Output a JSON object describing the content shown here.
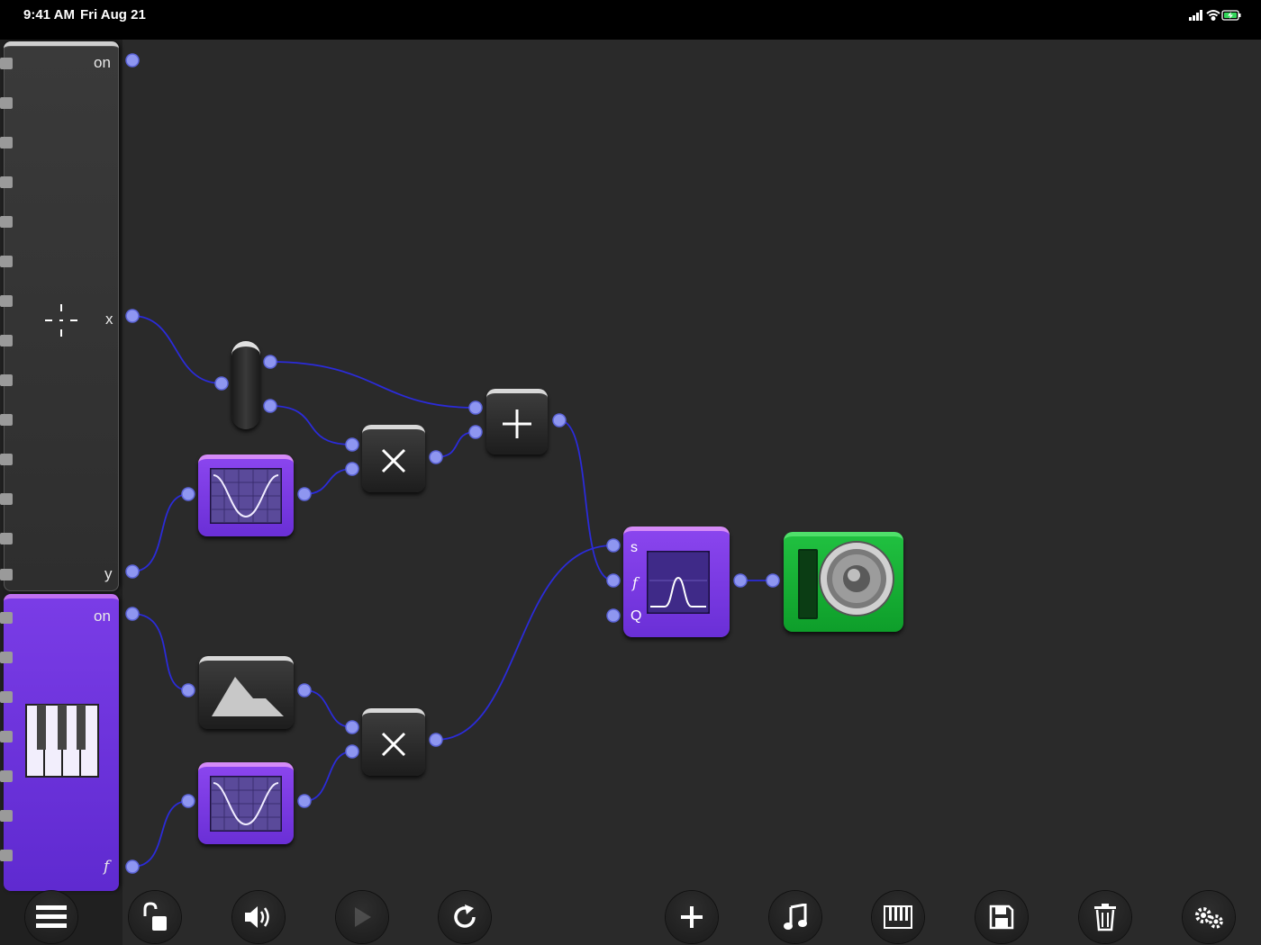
{
  "status_bar": {
    "time": "9:41 AM",
    "date": "Fri Aug 21",
    "icons": [
      "signal-icon",
      "wifi-icon",
      "battery-charging-icon"
    ]
  },
  "touchpad_module": {
    "on_label": "on",
    "x_label": "x",
    "y_label": "y"
  },
  "keyboard_module": {
    "on_label": "on",
    "f_label": "f"
  },
  "filter_module": {
    "s_label": "s",
    "f_label": "f",
    "q_label": "Q"
  },
  "nodes": [
    {
      "name": "switch-node",
      "icon": "pill-switch-icon"
    },
    {
      "name": "oscillator-node-top",
      "icon": "sine-wave-icon"
    },
    {
      "name": "multiply-node-top",
      "icon": "multiply-icon"
    },
    {
      "name": "add-node",
      "icon": "plus-icon"
    },
    {
      "name": "envelope-node",
      "icon": "envelope-icon"
    },
    {
      "name": "oscillator-node-bottom",
      "icon": "sine-wave-icon"
    },
    {
      "name": "multiply-node-bottom",
      "icon": "multiply-icon"
    },
    {
      "name": "filter-node",
      "icon": "bandpass-icon"
    },
    {
      "name": "speaker-node",
      "icon": "speaker-icon"
    }
  ],
  "toolbar": [
    {
      "name": "menu-button",
      "icon": "menu-icon"
    },
    {
      "name": "lock-button",
      "icon": "unlock-icon"
    },
    {
      "name": "volume-button",
      "icon": "volume-icon"
    },
    {
      "name": "play-button",
      "icon": "play-icon"
    },
    {
      "name": "reset-button",
      "icon": "refresh-icon"
    },
    {
      "name": "add-button",
      "icon": "plus-icon"
    },
    {
      "name": "music-button",
      "icon": "music-note-icon"
    },
    {
      "name": "keyboard-button",
      "icon": "piano-icon"
    },
    {
      "name": "save-button",
      "icon": "floppy-icon"
    },
    {
      "name": "delete-button",
      "icon": "trash-icon"
    },
    {
      "name": "settings-button",
      "icon": "gears-icon"
    }
  ],
  "colors": {
    "background": "#2a2a2a",
    "wire": "#2b2bd8",
    "port": "#8e96f0",
    "purple_module": "#6a2fd6",
    "green_module": "#0e9e2a"
  }
}
